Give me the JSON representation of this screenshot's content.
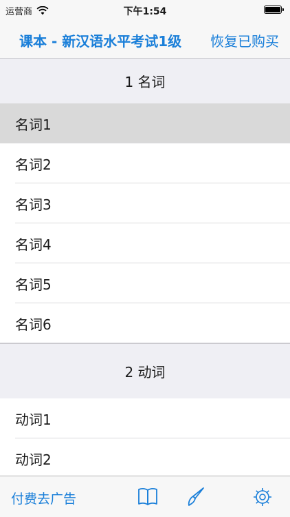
{
  "status_bar": {
    "carrier": "运营商",
    "time": "下午1:54"
  },
  "nav": {
    "title": "课本 - 新汉语水平考试1级",
    "restore_label": "恢复已购买"
  },
  "sections": [
    {
      "header": "1 名词",
      "rows": [
        "名词1",
        "名词2",
        "名词3",
        "名词4",
        "名词5",
        "名词6"
      ]
    },
    {
      "header": "2 动词",
      "rows": [
        "动词1",
        "动词2"
      ]
    }
  ],
  "toolbar": {
    "remove_ads_label": "付费去广告"
  },
  "icons": {
    "wifi": "wifi-icon",
    "battery": "battery-icon",
    "book": "book-icon",
    "brush": "brush-icon",
    "gear": "gear-icon"
  },
  "colors": {
    "accent": "#1a7fd9",
    "selected_row": "#d9d9d9",
    "section_bg": "#efeff4"
  }
}
